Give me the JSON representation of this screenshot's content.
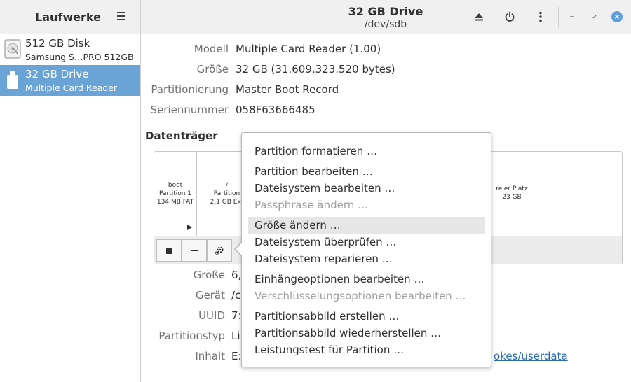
{
  "header": {
    "app_title": "Laufwerke",
    "drive_title": "32 GB Drive",
    "drive_subtitle": "/dev/sdb"
  },
  "sidebar": {
    "items": [
      {
        "name": "512 GB Disk",
        "subtitle": "Samsung S…PRO 512GB",
        "icon": "disk-icon",
        "selected": false
      },
      {
        "name": "32 GB Drive",
        "subtitle": "Multiple Card  Reader",
        "icon": "usb-drive-icon",
        "selected": true
      }
    ]
  },
  "drive_info": [
    {
      "label": "Modell",
      "value": "Multiple Card  Reader (1.00)"
    },
    {
      "label": "Größe",
      "value": "32 GB (31.609.323.520 bytes)"
    },
    {
      "label": "Partitionierung",
      "value": "Master Boot Record"
    },
    {
      "label": "Seriennummer",
      "value": "058F63666485"
    }
  ],
  "volumes": {
    "section_title": "Datenträger",
    "segments": [
      {
        "line1": "boot",
        "line2": "Partition 1",
        "line3": "134 MB FAT"
      },
      {
        "line1": "/",
        "line2": "Partition",
        "line3": "2,1 GB Ext"
      },
      {
        "line1": "reier Platz",
        "line2": "23 GB"
      }
    ]
  },
  "partition_info": [
    {
      "label": "Größe",
      "value": "6,"
    },
    {
      "label": "Gerät",
      "value": "/c"
    },
    {
      "label": "UUID",
      "value": "7:"
    },
    {
      "label": "Partitionstyp",
      "value": "Li"
    },
    {
      "label": "Inhalt",
      "value": "E:",
      "link": "okes/userdata"
    }
  ],
  "menu": {
    "items": [
      {
        "label": "Partition formatieren …",
        "disabled": false
      },
      {
        "label": "Partition bearbeiten …",
        "disabled": false
      },
      {
        "label": "Dateisystem bearbeiten …",
        "disabled": false
      },
      {
        "label": "Passphrase ändern …",
        "disabled": true
      },
      {
        "label": "Größe ändern …",
        "disabled": false,
        "hover": true
      },
      {
        "label": "Dateisystem überprüfen …",
        "disabled": false
      },
      {
        "label": "Dateisystem reparieren …",
        "disabled": false
      },
      {
        "label": "Einhängeoptionen bearbeiten …",
        "disabled": false
      },
      {
        "label": "Verschlüsselungsoptionen bearbeiten …",
        "disabled": true
      },
      {
        "label": "Partitionsabbild erstellen …",
        "disabled": false
      },
      {
        "label": "Partitionsabbild wiederherstellen …",
        "disabled": false
      },
      {
        "label": "Leistungstest für Partition …",
        "disabled": false
      }
    ]
  },
  "colors": {
    "selection": "#6aa3d5",
    "link": "#2a6ab0",
    "close_button": "#5aa0e0"
  }
}
